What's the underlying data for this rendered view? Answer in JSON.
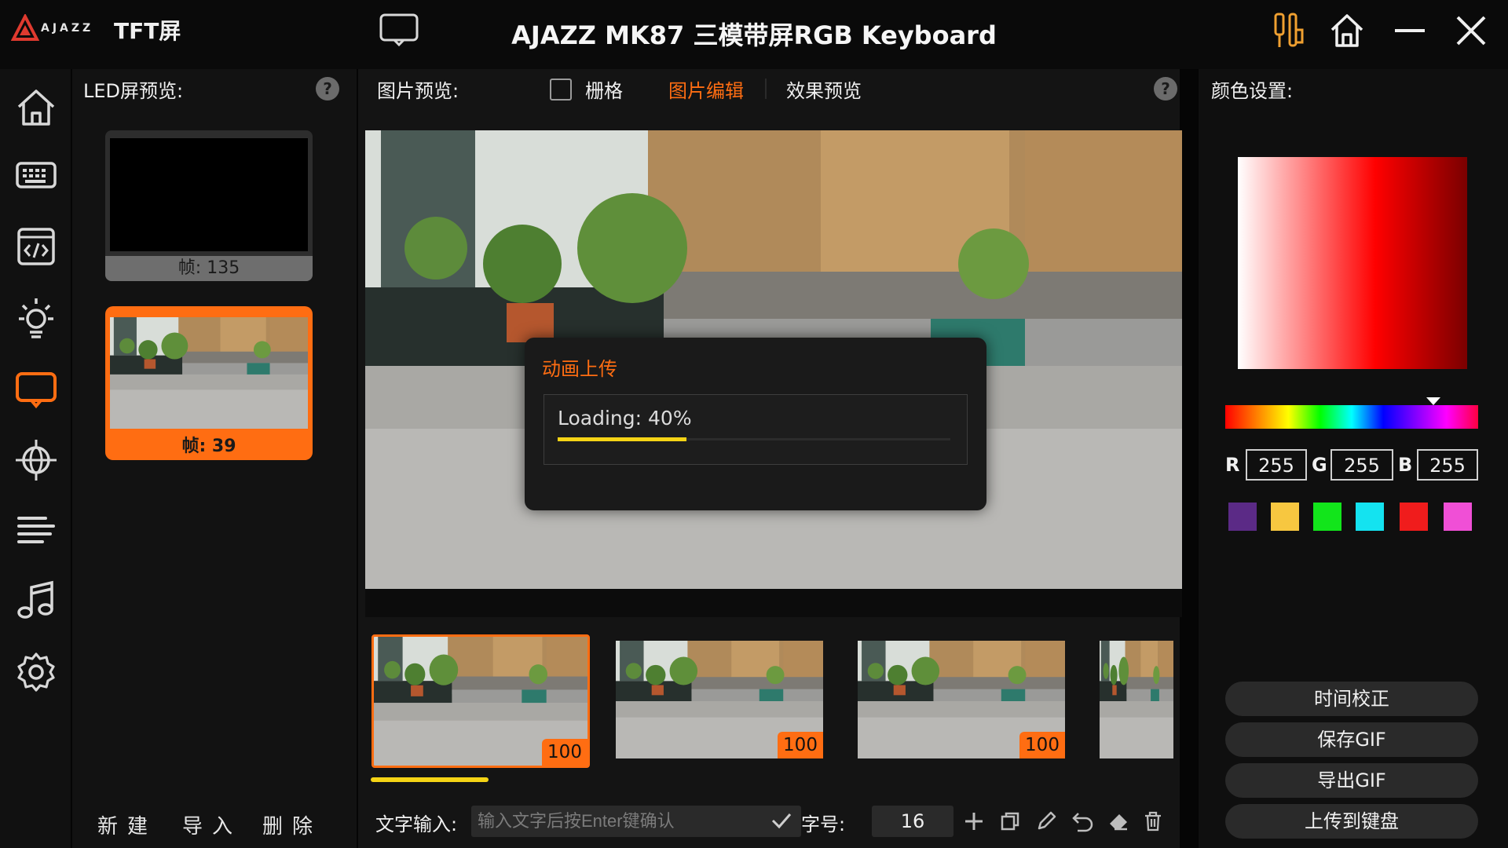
{
  "header": {
    "brand": "AJAZZ",
    "app_name": "TFT屏",
    "title": "AJAZZ MK87 三模带屏RGB Keyboard",
    "icons": [
      "screen-icon",
      "tools-icon",
      "home-icon",
      "minimize-icon",
      "close-icon"
    ]
  },
  "nav": {
    "items": [
      "home-icon",
      "keyboard-icon",
      "code-icon",
      "light-icon",
      "screen-icon",
      "network-icon",
      "text-align-icon",
      "music-icon",
      "gear-icon"
    ],
    "active": "screen-icon"
  },
  "left_panel": {
    "title": "LED屏预览:",
    "help": "?",
    "frames": [
      {
        "label": "帧: 135"
      },
      {
        "label": "帧: 39"
      }
    ],
    "buttons": {
      "new": "新建",
      "import": "导入",
      "delete": "删除"
    }
  },
  "center_panel": {
    "title": "图片预览:",
    "grid_label": "栅格",
    "tabs": [
      {
        "label": "图片编辑",
        "active": true
      },
      {
        "label": "效果预览",
        "active": false
      }
    ],
    "help": "?",
    "dialog": {
      "title": "动画上传",
      "loading_text": "Loading: 40%",
      "progress": 0.4
    },
    "thumbnails": [
      {
        "badge": "100",
        "selected": true
      },
      {
        "badge": "100",
        "selected": false
      },
      {
        "badge": "100",
        "selected": false
      },
      {
        "badge": "",
        "selected": false
      }
    ],
    "text_input": {
      "label": "文字输入:",
      "placeholder": "输入文字后按Enter键确认",
      "value": ""
    },
    "font_size": {
      "label": "字号:",
      "value": "16"
    },
    "tools": [
      "plus-icon",
      "copy-icon",
      "pencil-icon",
      "undo-icon",
      "eraser-icon",
      "trash-icon"
    ]
  },
  "right_panel": {
    "title": "颜色设置:",
    "rgb": {
      "r_label": "R",
      "g_label": "G",
      "b_label": "B",
      "r": "255",
      "g": "255",
      "b": "255"
    },
    "swatches": [
      "#5b2a86",
      "#f7c740",
      "#12e51b",
      "#14e3f0",
      "#f01c1c",
      "#f04fd6"
    ],
    "buttons": {
      "time": "时间校正",
      "save_gif": "保存GIF",
      "export_gif": "导出GIF",
      "upload": "上传到键盘"
    }
  },
  "colors": {
    "accent": "#ff6d12",
    "progress": "#f5d415",
    "background": "#050505"
  }
}
